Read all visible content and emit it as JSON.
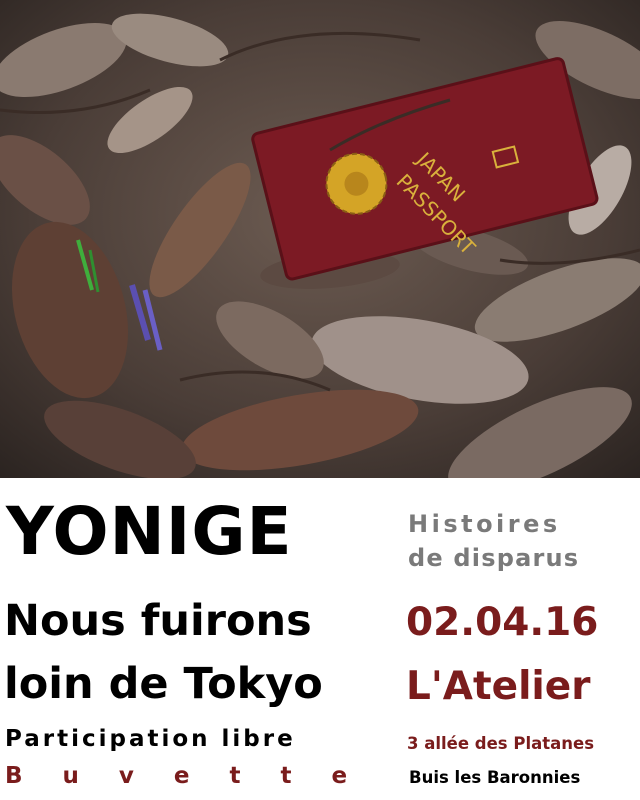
{
  "poster": {
    "title": "YONIGE",
    "subtitle_line1": "Histoires",
    "subtitle_line2": "de disparus",
    "heading_line1": "Nous fuirons",
    "heading_line2": "loin de Tokyo",
    "date": "02.04.16",
    "venue": "L'Atelier",
    "entry": "Participation libre",
    "bar": "Buvette",
    "address": "3 allée des Platanes",
    "town": "Buis les Baronnies"
  },
  "photo": {
    "passport_line1": "JAPAN",
    "passport_line2": "PASSPORT",
    "passport_color": "#7c1a24",
    "emblem_color": "#d4a426"
  },
  "colors": {
    "dark_red": "#7a1c1c",
    "grey": "#7a7a7a"
  }
}
